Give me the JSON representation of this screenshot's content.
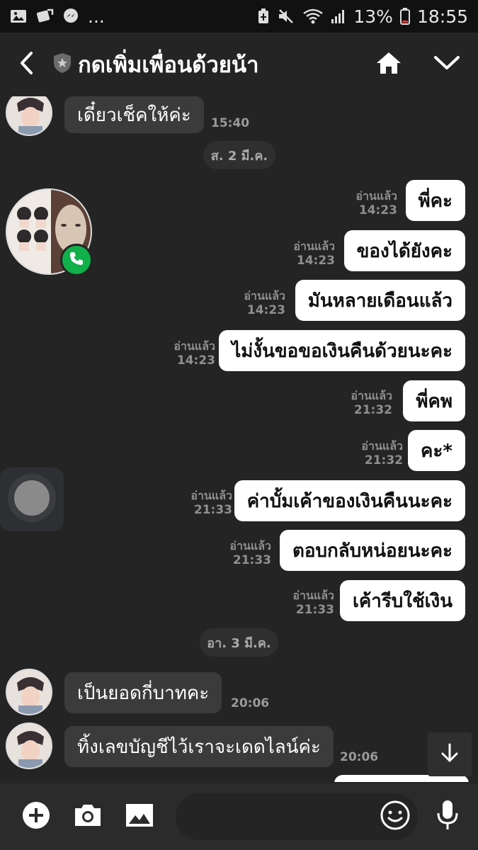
{
  "status_bar": {
    "more": "...",
    "battery": "13%",
    "clock": "18:55"
  },
  "header": {
    "title": "กดเพิ่มเพื่อนด้วยน้า"
  },
  "messages": {
    "m1": {
      "text": "เดี๋ยวเช็คให้ค่ะ",
      "time": "15:40"
    },
    "date1": "ส. 2 มี.ค.",
    "o1": {
      "text": "พี่คะ",
      "read": "อ่านแล้ว",
      "time": "14:23"
    },
    "o2": {
      "text": "ของได้ยังคะ",
      "read": "อ่านแล้ว",
      "time": "14:23"
    },
    "o3": {
      "text": "มันหลายเดือนแล้ว",
      "read": "อ่านแล้ว",
      "time": "14:23"
    },
    "o4": {
      "text": "ไม่งั้นขอขอเงินคืนด้วยนะคะ",
      "read": "อ่านแล้ว",
      "time": "14:23"
    },
    "o5": {
      "text": "พี่คพ",
      "read": "อ่านแล้ว",
      "time": "21:32"
    },
    "o6": {
      "text": "คะ*",
      "read": "อ่านแล้ว",
      "time": "21:32"
    },
    "o7": {
      "text": "ค่าบั้มเค้าของเงินคืนนะคะ",
      "read": "อ่านแล้ว",
      "time": "21:33"
    },
    "o8": {
      "text": "ตอบกลับหน่อยนะคะ",
      "read": "อ่านแล้ว",
      "time": "21:33"
    },
    "o9": {
      "text": "เค้ารีบใช้เงิน",
      "read": "อ่านแล้ว",
      "time": "21:33"
    },
    "date2": "อา. 3 มี.ค.",
    "m2": {
      "text": "เป็นยอดกี่บาทคะ",
      "time": "20:06"
    },
    "m3": {
      "text": "ทิ้งเลขบัญชีไว้เราจะเดดไลน์ค่ะ",
      "time": "20:06"
    }
  },
  "input": {
    "placeholder": ""
  },
  "icons": {
    "status_left": [
      "gallery-icon",
      "screenshot-icon",
      "messenger-icon"
    ],
    "status_right": [
      "battery-saver-icon",
      "mute-icon",
      "wifi-icon",
      "signal-icon",
      "battery-icon"
    ],
    "header": [
      "back-icon",
      "shield-icon",
      "home-icon",
      "chevron-down-icon"
    ],
    "input_bar": [
      "plus-icon",
      "camera-icon",
      "image-icon",
      "emoji-icon",
      "mic-icon"
    ]
  },
  "colors": {
    "background": "#242424",
    "incoming_bubble": "#3b3b3b",
    "outgoing_bubble": "#ffffff",
    "call_badge": "#11b04a"
  }
}
